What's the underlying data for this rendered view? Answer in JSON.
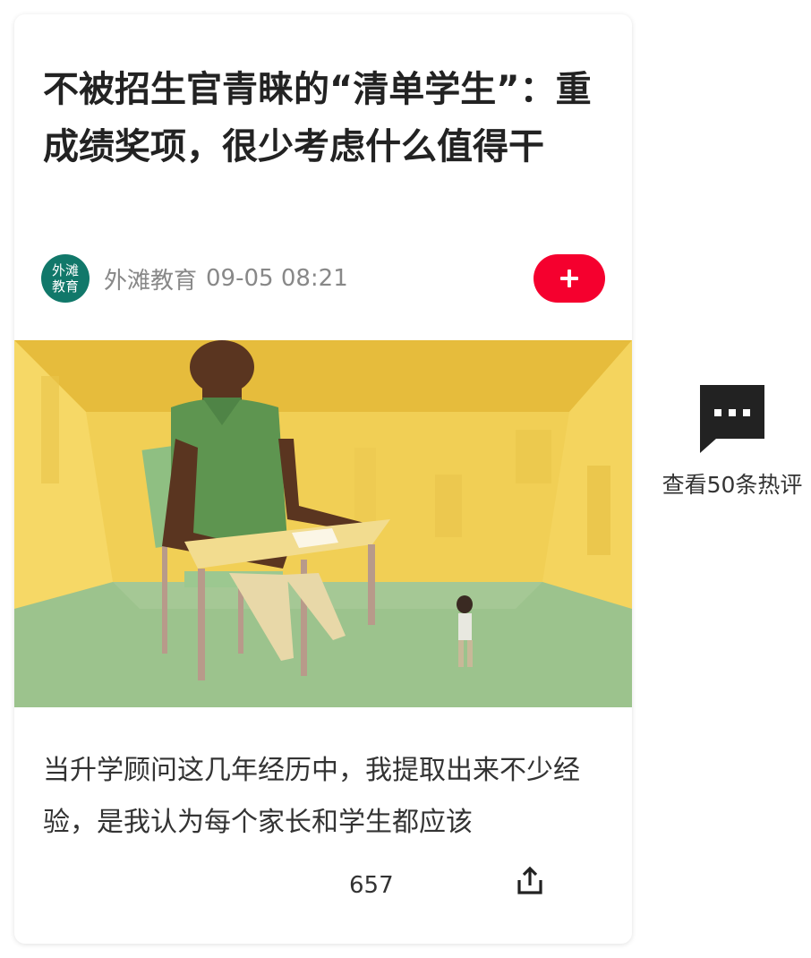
{
  "article": {
    "title": "不被招生官青睐的“清单学生”：重成绩奖项，很少考虑什么值得干",
    "source": {
      "name": "外滩教育",
      "avatar_text": "外滩教育",
      "avatar_color": "#11786a"
    },
    "time": "09-05 08:21",
    "follow": {
      "icon": "plus-icon",
      "color": "#f5002e"
    },
    "image": {
      "description_icon": "illustration-image",
      "dominant_colors": [
        "#f1cf55",
        "#9cc38d",
        "#5e9550",
        "#5a3520"
      ]
    },
    "summary": "当升学顾问这几年经历中，我提取出来不少经验，是我认为每个家长和学生都应该",
    "read_count": "657",
    "share": {
      "icon": "share-icon"
    }
  },
  "side": {
    "comments_icon": "comment-bubble-icon",
    "comments_label": "查看50条热评"
  }
}
